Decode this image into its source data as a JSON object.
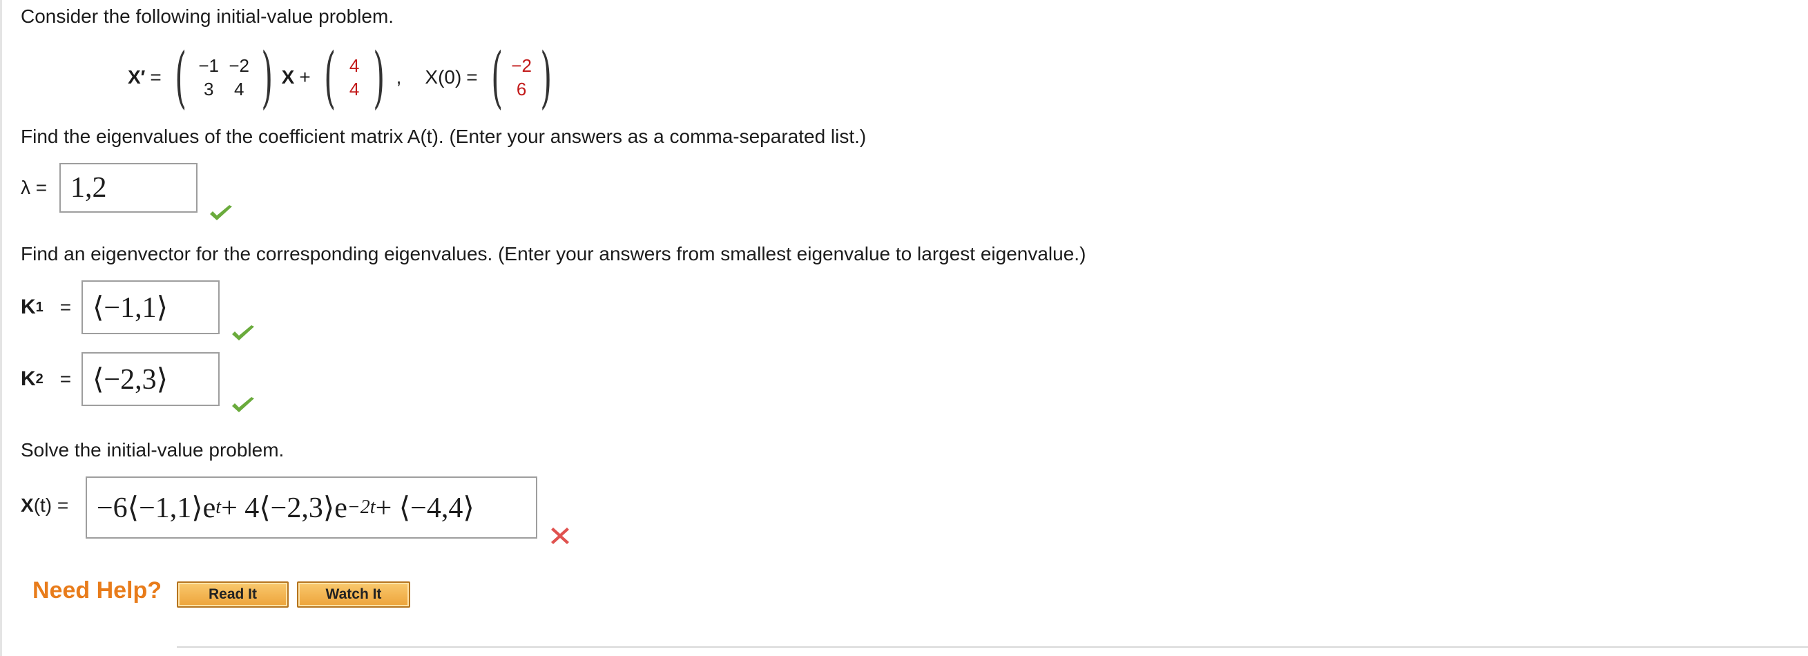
{
  "problem": {
    "intro": "Consider the following initial-value problem.",
    "equation": {
      "lhs": "X′",
      "eq_sign": "=",
      "matrix": [
        [
          "−1",
          "−2"
        ],
        [
          "3",
          "4"
        ]
      ],
      "x_symbol": "X",
      "plus": "+",
      "forcing_vector": [
        "4",
        "4"
      ],
      "comma": ",",
      "ic_label": "X(0)",
      "ic_eq": "=",
      "ic_vector": [
        "−2",
        "6"
      ]
    }
  },
  "eigen": {
    "prompt": "Find the eigenvalues of the coefficient matrix A(t). (Enter your answers as a comma-separated list.)",
    "label": "λ =",
    "answer": "1,2",
    "status": "correct"
  },
  "eigvec": {
    "prompt": "Find an eigenvector for the corresponding eigenvalues. (Enter your answers from smallest eigenvalue to largest eigenvalue.)",
    "k1_label": "K",
    "k1_sub": "1",
    "k1_eq": "=",
    "k1_answer": "⟨−1,1⟩",
    "k1_status": "correct",
    "k2_label": "K",
    "k2_sub": "2",
    "k2_eq": "=",
    "k2_answer": "⟨−2,3⟩",
    "k2_status": "correct"
  },
  "solution": {
    "prompt": "Solve the initial-value problem.",
    "label_bold": "X",
    "label_rest": "(t) =",
    "answer_part1": "−6⟨−1,1⟩e",
    "answer_exp1": "t",
    "answer_part2": " + 4⟨−2,3⟩e",
    "answer_exp2": "−2t",
    "answer_part3": " + ⟨−4,4⟩",
    "status": "incorrect"
  },
  "help": {
    "title": "Need Help?",
    "read_label": "Read It",
    "watch_label": "Watch It"
  },
  "icons": {
    "check": "check-icon",
    "cross": "cross-icon",
    "check_color": "#6aab3c",
    "cross_color": "#e0524f"
  }
}
